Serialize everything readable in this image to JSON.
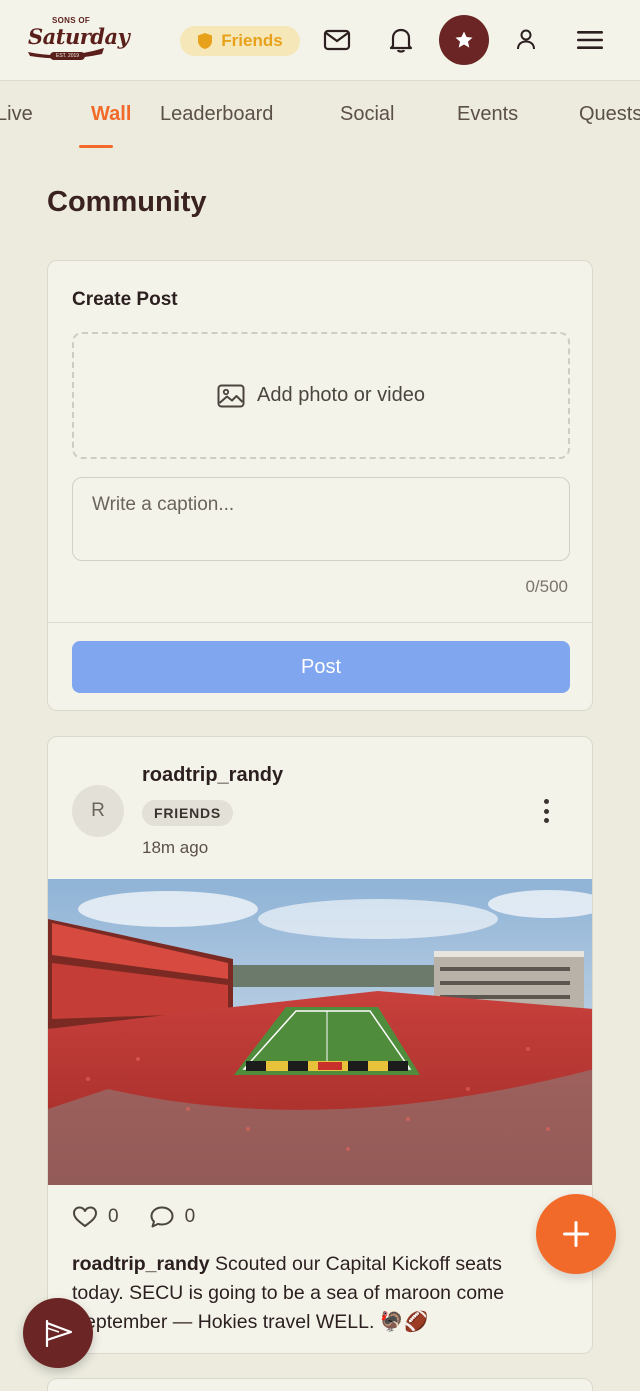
{
  "header": {
    "logo": {
      "top_text": "SONS OF",
      "main_text": "Saturday",
      "est_text": "EST. 2019"
    },
    "friends_pill": {
      "label": "Friends",
      "icon": "shield-icon",
      "color": "#e8a11a"
    },
    "icons": [
      "mail-icon",
      "bell-icon",
      "star-icon",
      "user-icon",
      "menu-icon"
    ]
  },
  "tabs": [
    {
      "label": "Live",
      "active": false
    },
    {
      "label": "Wall",
      "active": true
    },
    {
      "label": "Leaderboard",
      "active": false
    },
    {
      "label": "Social",
      "active": false
    },
    {
      "label": "Events",
      "active": false
    },
    {
      "label": "Quests",
      "active": false
    }
  ],
  "page_title": "Community",
  "create_post": {
    "title": "Create Post",
    "media_label": "Add photo or video",
    "caption_placeholder": "Write a caption...",
    "char_count": "0/500",
    "post_button": "Post",
    "post_button_color": "#7fa6ef"
  },
  "feed": [
    {
      "avatar_initial": "R",
      "username": "roadtrip_randy",
      "badge": "FRIENDS",
      "time": "18m ago",
      "likes": "0",
      "comments": "0",
      "text_user": "roadtrip_randy",
      "text": "Scouted our Capital Kickoff seats today. SECU is going to be a sea of maroon come September — Hokies travel WELL. 🦃🏈"
    }
  ],
  "colors": {
    "accent": "#f26a2a",
    "brand": "#6a2524",
    "background": "#ecebde"
  }
}
